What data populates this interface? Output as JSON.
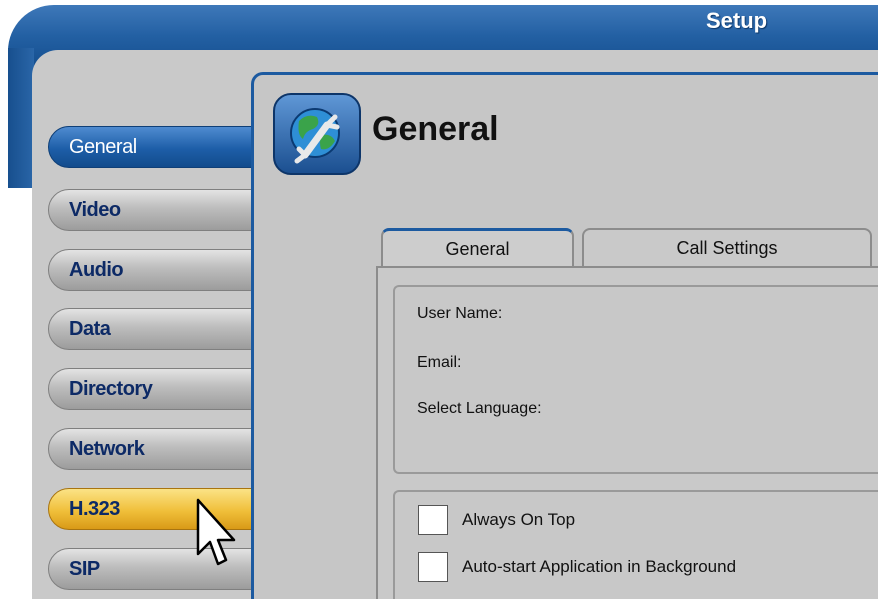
{
  "window": {
    "title": "Setup"
  },
  "sidebar": {
    "items": [
      {
        "label": "General",
        "state": "active"
      },
      {
        "label": "Video"
      },
      {
        "label": "Audio"
      },
      {
        "label": "Data"
      },
      {
        "label": "Directory"
      },
      {
        "label": "Network"
      },
      {
        "label": "H.323",
        "state": "hover"
      },
      {
        "label": "SIP"
      }
    ]
  },
  "panel": {
    "title": "General",
    "icon": "globe-wrench-icon"
  },
  "tabs": [
    {
      "label": "General",
      "active": true
    },
    {
      "label": "Call Settings",
      "active": false
    }
  ],
  "general_tab": {
    "fields": [
      {
        "label": "User Name:"
      },
      {
        "label": "Email:"
      },
      {
        "label": "Select Language:"
      }
    ],
    "options": [
      {
        "label": "Always On Top",
        "checked": false
      },
      {
        "label": "Auto-start Application in Background",
        "checked": false
      }
    ]
  },
  "colors": {
    "accent_blue": "#1c5aa0",
    "panel_gray": "#c6c6c6",
    "hover_yellow": "#f0bf3a",
    "nav_text": "#0d2a66"
  }
}
